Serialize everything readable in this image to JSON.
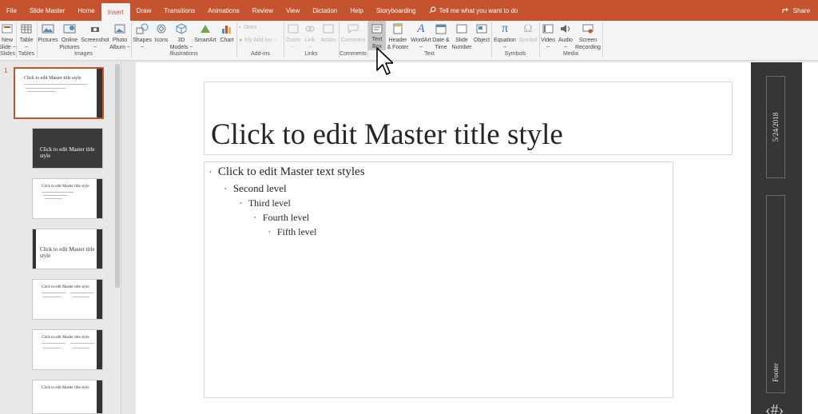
{
  "tabs": [
    {
      "label": "File",
      "active": false
    },
    {
      "label": "Slide Master",
      "active": false
    },
    {
      "label": "Home",
      "active": false
    },
    {
      "label": "Insert",
      "active": true
    },
    {
      "label": "Draw",
      "active": false
    },
    {
      "label": "Transitions",
      "active": false
    },
    {
      "label": "Animations",
      "active": false
    },
    {
      "label": "Review",
      "active": false
    },
    {
      "label": "View",
      "active": false
    },
    {
      "label": "Dictation",
      "active": false
    },
    {
      "label": "Help",
      "active": false
    },
    {
      "label": "Storyboarding",
      "active": false
    }
  ],
  "tell_me": "Tell me what you want to do",
  "share_label": "Share",
  "ribbon": {
    "new_slide": "New\nSlide ~",
    "table": "Table\n~",
    "pictures": "Pictures",
    "online_pictures": "Online\nPictures",
    "screenshot": "Screenshot\n~",
    "photo_album": "Photo\nAlbum ~",
    "shapes": "Shapes\n~",
    "icons": "Icons",
    "models_3d": "3D\nModels ~",
    "smartart": "SmartArt",
    "chart": "Chart",
    "store": "Store",
    "my_addins": "My Add-ins ~",
    "zoom": "Zoom\n~",
    "link": "Link\n~",
    "action": "Action",
    "comment": "Comment",
    "text_box": "Text\nBox",
    "header_footer": "Header\n& Footer",
    "wordart": "WordArt\n~",
    "date_time": "Date &\nTime",
    "slide_number": "Slide\nNumber",
    "object": "Object",
    "equation": "Equation\n~",
    "symbol": "Symbol",
    "video": "Video\n~",
    "audio": "Audio\n~",
    "screen_recording": "Screen\nRecording",
    "groups": {
      "slides": "Slides",
      "tables": "Tables",
      "images": "Images",
      "illustrations": "Illustrations",
      "addins": "Add-ins",
      "links": "Links",
      "comments": "Comments",
      "text": "Text",
      "symbols": "Symbols",
      "media": "Media"
    }
  },
  "thumbnails": {
    "slide_number": "1",
    "master_title": "Click to edit Master title style",
    "layout_title_dark": "Click to edit Master title style",
    "layout_title_2": "Click to edit Master title style"
  },
  "slide": {
    "title": "Click to edit Master title style",
    "levels": [
      "Click to edit Master text styles",
      "Second level",
      "Third level",
      "Fourth level",
      "Fifth level"
    ],
    "date": "5/24/2018",
    "footer": "Footer",
    "page_number_symbol": "‹#›"
  },
  "icons": {
    "search": "search-icon",
    "share": "share-icon",
    "cursor": "mouse-pointer-icon"
  }
}
